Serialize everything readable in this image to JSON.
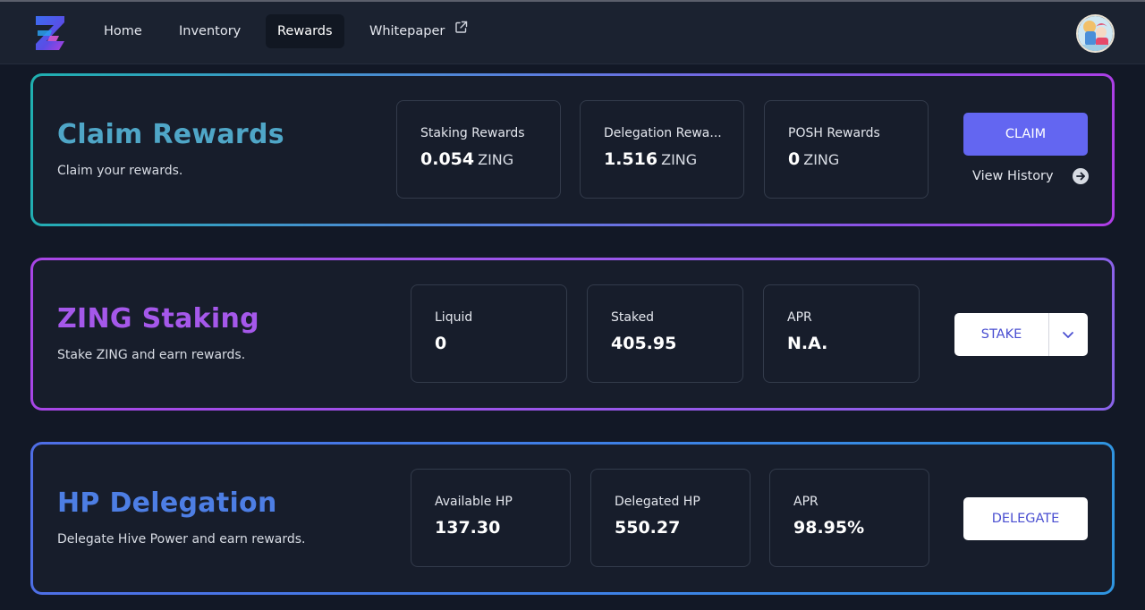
{
  "nav": {
    "links": [
      {
        "label": "Home"
      },
      {
        "label": "Inventory"
      },
      {
        "label": "Rewards",
        "active": true
      },
      {
        "label": "Whitepaper",
        "external": true
      }
    ]
  },
  "claim": {
    "title": "Claim Rewards",
    "subtitle": "Claim your rewards.",
    "stats": [
      {
        "label": "Staking Rewards",
        "value": "0.054",
        "unit": "ZING"
      },
      {
        "label": "Delegation Rewa...",
        "value": "1.516",
        "unit": "ZING"
      },
      {
        "label": "POSH Rewards",
        "value": "0",
        "unit": "ZING"
      }
    ],
    "claim_label": "CLAIM",
    "history_label": "View History"
  },
  "staking": {
    "title": "ZING Staking",
    "subtitle": "Stake ZING and earn rewards.",
    "stats": [
      {
        "label": "Liquid",
        "value": "0"
      },
      {
        "label": "Staked",
        "value": "405.95"
      },
      {
        "label": "APR",
        "value": "N.A."
      }
    ],
    "stake_label": "STAKE"
  },
  "delegation": {
    "title": "HP Delegation",
    "subtitle": "Delegate Hive Power and earn rewards.",
    "stats": [
      {
        "label": "Available HP",
        "value": "137.30"
      },
      {
        "label": "Delegated HP",
        "value": "550.27"
      },
      {
        "label": "APR",
        "value": "98.95%"
      }
    ],
    "delegate_label": "DELEGATE"
  },
  "colors": {
    "accent": "#6366f1",
    "claim_title": "#4fa6c7",
    "staking_title": "#a558ea",
    "delegation_title": "#4d7ee4",
    "background": "#121826"
  },
  "icons": [
    "app-logo-icon",
    "external-link-icon",
    "arrow-right-circle-icon",
    "chevron-down-icon"
  ]
}
